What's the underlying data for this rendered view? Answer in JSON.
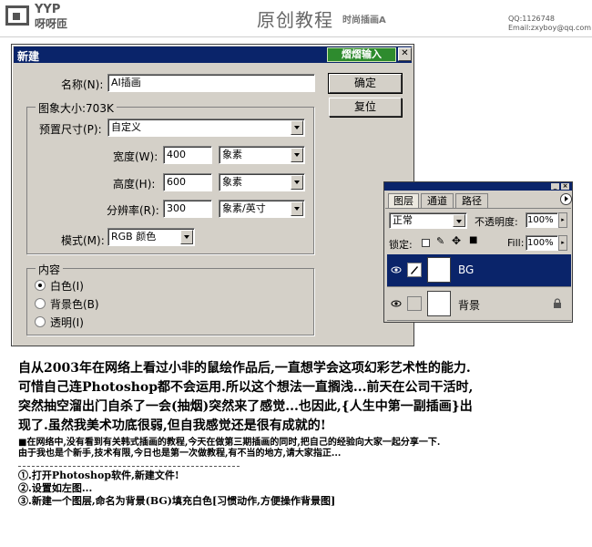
{
  "header": {
    "logo_line1": "YYP",
    "logo_line2": "呀呀匝",
    "title": "原创教程",
    "subtitle": "时尚插画A",
    "qq": "QQ:1126748",
    "email": "Email:zxyboy@qq.com"
  },
  "dialog": {
    "title": "新建",
    "badge": "熠熠输入",
    "close": "✕",
    "name_label": "名称(N):",
    "name_value": "AI插画",
    "image_size_label": "图象大小:703K",
    "preset_label": "预置尺寸(P):",
    "preset_value": "自定义",
    "width_label": "宽度(W):",
    "width_value": "400",
    "width_unit": "象素",
    "height_label": "高度(H):",
    "height_value": "600",
    "height_unit": "象素",
    "resolution_label": "分辨率(R):",
    "resolution_value": "300",
    "resolution_unit": "象素/英寸",
    "mode_label": "模式(M):",
    "mode_value": "RGB 颜色",
    "ok_button": "确定",
    "reset_button": "复位",
    "contents_title": "内容",
    "contents_options": [
      {
        "label": "白色(I)",
        "selected": true
      },
      {
        "label": "背景色(B)",
        "selected": false
      },
      {
        "label": "透明(I)",
        "selected": false
      }
    ]
  },
  "layers_panel": {
    "tabs": [
      "图层",
      "通道",
      "路径"
    ],
    "blend_mode": "正常",
    "opacity_label": "不透明度:",
    "opacity_value": "100%",
    "lock_label": "锁定:",
    "fill_label": "Fill:",
    "fill_value": "100%",
    "layers": [
      {
        "name": "BG",
        "selected": true
      },
      {
        "name": "背景",
        "selected": false
      }
    ]
  },
  "article": {
    "paragraph_lines": [
      "自从2003年在网络上看过小非的鼠绘作品后,一直想学会这项幻彩艺术性的能力.",
      "可惜自己连Photoshop都不会运用.所以这个想法一直搁浅...前天在公司干活时,",
      "突然抽空溜出门自杀了一会(抽烟)突然来了感觉...也因此,{人生中第一副插画}出",
      "现了.虽然我美术功底很弱,但自我感觉还是很有成就的!"
    ],
    "note_lines": [
      "■在网络中,没有看到有关韩式插画的教程,今天在做第三期插画的同时,把自己的经验向大家一起分享一下.",
      "由于我也是个新手,技术有限,今日也是第一次做教程,有不当的地方,请大家指正..."
    ],
    "steps": [
      "①.打开Photoshop软件,新建文件!",
      "②.设置如左图...",
      "③.新建一个图层,命名为背景(BG)填充白色[习惯动作,方便操作背景图]"
    ]
  }
}
